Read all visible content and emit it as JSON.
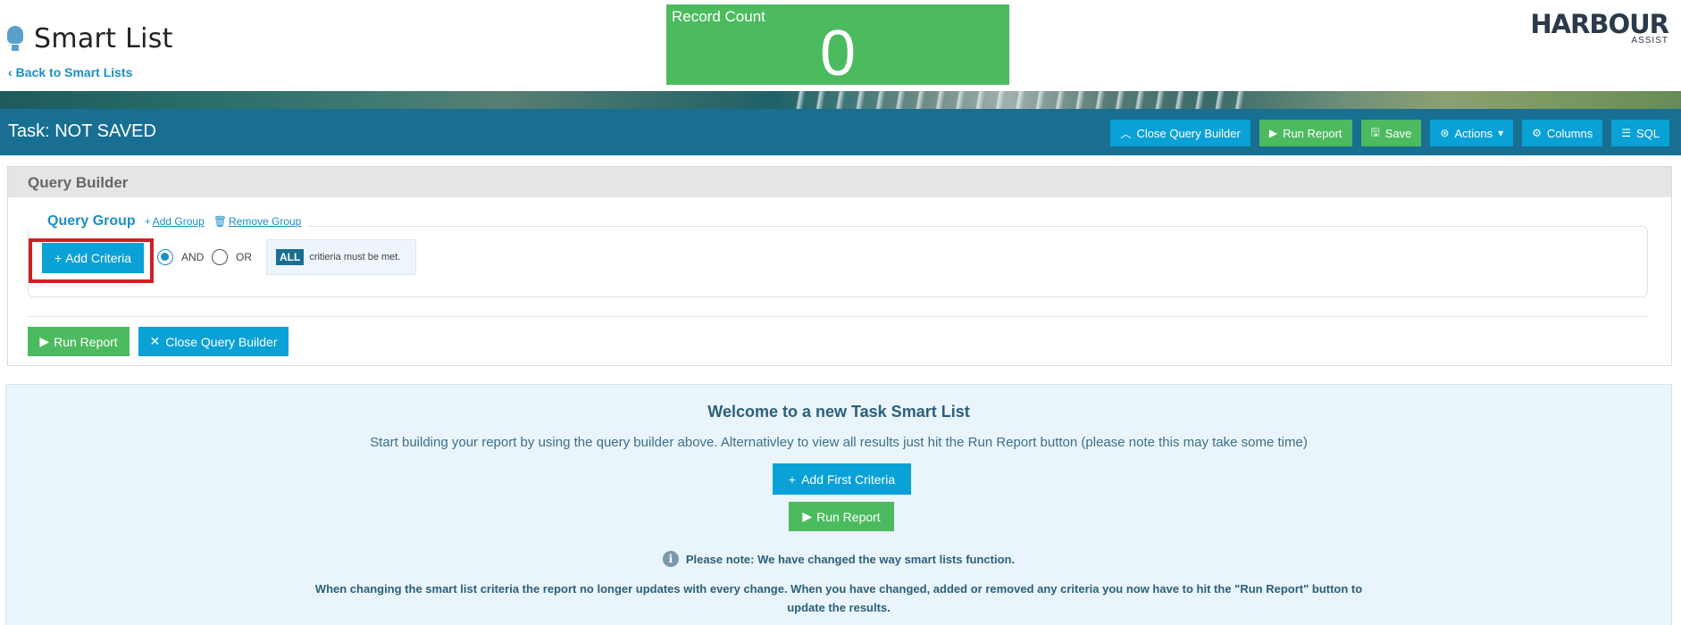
{
  "header": {
    "title": "Smart List",
    "back_link": "Back to Smart Lists",
    "record_count_label": "Record Count",
    "record_count_value": "0",
    "logo_text": "HARBOUR",
    "logo_sub": "ASSIST"
  },
  "taskbar": {
    "title": "Task: NOT SAVED",
    "buttons": {
      "close_qb": "Close Query Builder",
      "run_report": "Run Report",
      "save": "Save",
      "actions": "Actions",
      "columns": "Columns",
      "sql": "SQL"
    }
  },
  "query_builder": {
    "heading": "Query Builder",
    "group_title": "Query Group",
    "add_group": "Add Group",
    "remove_group": "Remove Group",
    "add_criteria": "Add Criteria",
    "radio_and": "AND",
    "radio_or": "OR",
    "selected_logic": "AND",
    "all_badge": "ALL",
    "criteria_hint": "critieria must be met.",
    "run_report": "Run Report",
    "close_qb": "Close Query Builder"
  },
  "welcome": {
    "heading": "Welcome to a new Task Smart List",
    "intro": "Start building your report by using the query builder above. Alternativley to view all results just hit the Run Report button (please note this may take some time)",
    "add_first": "Add First Criteria",
    "run_report": "Run Report",
    "note": "Please note: We have changed the way smart lists function.",
    "description": "When changing the smart list criteria the report no longer updates with every change. When you have changed, added or removed any criteria you now have to hit the \"Run Report\" button to update the results."
  },
  "colors": {
    "primary_blue": "#0aa1d6",
    "task_bar": "#186f92",
    "success_green": "#4cbb5f",
    "highlight_red": "#d01f25"
  }
}
